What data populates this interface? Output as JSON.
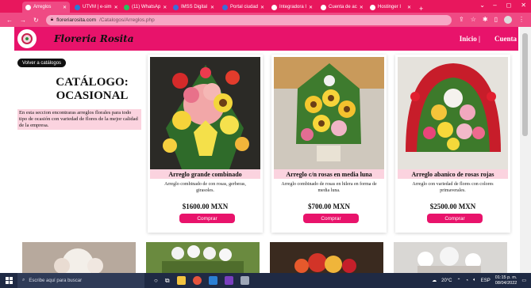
{
  "browser": {
    "tabs": [
      {
        "label": "Arreglos",
        "active": true
      },
      {
        "label": "UTVM | e-sim"
      },
      {
        "label": "(11) WhatsAp"
      },
      {
        "label": "IMSS Digital"
      },
      {
        "label": "Portal ciudad"
      },
      {
        "label": "Integradora I"
      },
      {
        "label": "Cuenta de ac"
      },
      {
        "label": "Hostinger I"
      }
    ],
    "new_tab": "+",
    "url_host": "floreriarosita.com",
    "url_path": "/Catalogos/Arreglos.php"
  },
  "site": {
    "brand": "Floreria Rosita",
    "nav": [
      "Inicio |",
      "Cuenta"
    ],
    "back_button": "Volver a catálogos",
    "catalog_title_line1": "CATÁLOGO:",
    "catalog_title_line2": "OCASIONAL",
    "catalog_description": "En esta seccion encontraras arreglos florales para todo tipo de ocasión con variedad de flores de la mejor calidad de la empresa.",
    "buy_label": "Comprar"
  },
  "products": [
    {
      "name": "Arreglo grande combinado",
      "description": "Arreglo combinado de con rosas, gerberas, girasoles.",
      "price": "$1600.00 MXN"
    },
    {
      "name": "Arreglo c/n rosas en media luna",
      "description": "Arreglo combinado de rosas en hilera en forma de media luna.",
      "price": "$700.00 MXN"
    },
    {
      "name": "Arreglo abanico de rosas rojas",
      "description": "Arreglo con variedad de flores con colores primaverales.",
      "price": "$2500.00 MXN"
    }
  ],
  "taskbar": {
    "search_placeholder": "Escribe aquí para buscar",
    "weather": "20°C",
    "lang": "ESP",
    "time": "01:15 p. m.",
    "date": "08/04/2022"
  },
  "colors": {
    "brand_pink": "#e8136b",
    "light_pink": "#fbd3df"
  }
}
